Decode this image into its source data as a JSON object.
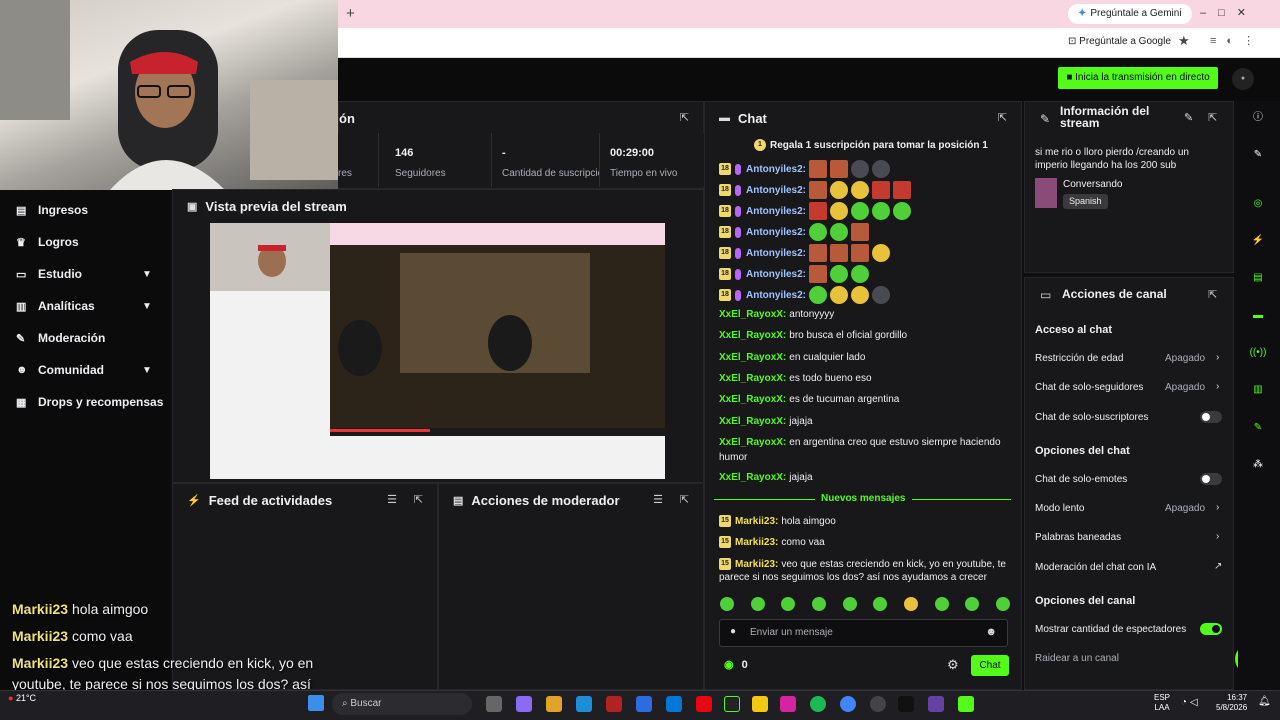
{
  "browser": {
    "gemini_label": "Pregúntale a Gemini",
    "google_label": "Pregúntale a Google",
    "new_tab": "+"
  },
  "topbar": {
    "golive_label": "Inicia la transmisión en directo"
  },
  "sidebar": {
    "items": [
      {
        "label": "Ingresos",
        "icon": "dollar-icon"
      },
      {
        "label": "Logros",
        "icon": "trophy-icon"
      },
      {
        "label": "Estudio",
        "icon": "studio-icon",
        "expandable": true
      },
      {
        "label": "Analíticas",
        "icon": "chart-icon",
        "expandable": true
      },
      {
        "label": "Moderación",
        "icon": "wrench-icon"
      },
      {
        "label": "Comunidad",
        "icon": "people-icon",
        "expandable": true
      },
      {
        "label": "Drops y recompensas",
        "icon": "gift-icon"
      }
    ]
  },
  "session": {
    "title_fragment": "ón",
    "stats": [
      {
        "value": "",
        "label": "res"
      },
      {
        "value": "146",
        "label": "Seguidores"
      },
      {
        "value": "-",
        "label": "Cantidad de suscripciones"
      },
      {
        "value": "00:29:00",
        "label": "Tiempo en vivo"
      }
    ]
  },
  "preview": {
    "title": "Vista previa del stream"
  },
  "activity": {
    "title": "Feed de actividades"
  },
  "modactions": {
    "title": "Acciones de moderador"
  },
  "chat": {
    "title": "Chat",
    "pinned": "Regala 1 suscripción para tomar la posición 1",
    "sub_rows": [
      {
        "badge": "18",
        "user": "Antonyiles2:"
      },
      {
        "badge": "18",
        "user": "Antonyiles2:"
      },
      {
        "badge": "18",
        "user": "Antonyiles2:"
      },
      {
        "badge": "18",
        "user": "Antonyiles2:"
      },
      {
        "badge": "18",
        "user": "Antonyiles2:"
      },
      {
        "badge": "18",
        "user": "Antonyiles2:"
      },
      {
        "badge": "18",
        "user": "Antonyiles2:"
      }
    ],
    "messages": [
      {
        "user": "XxEl_RayoxX:",
        "text": "antonyyyy"
      },
      {
        "user": "XxEl_RayoxX:",
        "text": "bro busca el oficial gordillo"
      },
      {
        "user": "XxEl_RayoxX:",
        "text": "en cualquier lado"
      },
      {
        "user": "XxEl_RayoxX:",
        "text": "es todo bueno eso"
      },
      {
        "user": "XxEl_RayoxX:",
        "text": "es de tucuman argentina"
      },
      {
        "user": "XxEl_RayoxX:",
        "text": "jajaja"
      },
      {
        "user": "XxEl_RayoxX:",
        "text": "en argentina creo que estuvo siempre haciendo"
      },
      {
        "user": "",
        "text": "humor"
      },
      {
        "user": "XxEl_RayoxX:",
        "text": "jajaja"
      }
    ],
    "new_divider": "Nuevos mensajes",
    "new_messages": [
      {
        "badge": "15",
        "user": "Markii23:",
        "text": "hola aimgoo"
      },
      {
        "badge": "15",
        "user": "Markii23:",
        "text": "como vaa"
      },
      {
        "badge": "15",
        "user": "Markii23:",
        "text": "veo que estas creciendo en kick, yo en youtube, te"
      },
      {
        "badge": "",
        "user": "",
        "text": "parece si nos seguimos los dos? así nos ayudamos a crecer"
      }
    ],
    "input_placeholder": "Enviar un mensaje",
    "points": "0",
    "send_label": "Chat"
  },
  "info": {
    "title_line1": "Información del",
    "title_line2": "stream",
    "stream_title_1": "si me rio o lloro pierdo /creando un",
    "stream_title_2": "imperio llegando ha los 200 sub",
    "category": "Conversando",
    "language": "Spanish"
  },
  "channel_actions": {
    "title": "Acciones de canal",
    "sec_chat_access": "Acceso al chat",
    "age_restriction": "Restricción de edad",
    "age_value": "Apagado",
    "followers_only": "Chat de solo-seguidores",
    "followers_value": "Apagado",
    "subs_only": "Chat de solo-suscriptores",
    "subs_on": false,
    "sec_chat_options": "Opciones del chat",
    "emotes_only": "Chat de solo-emotes",
    "emotes_on": false,
    "slow_mode": "Modo lento",
    "slow_value": "Apagado",
    "banned_words": "Palabras baneadas",
    "ai_moderation": "Moderación del chat con IA",
    "sec_channel_options": "Opciones del canal",
    "show_viewers": "Mostrar cantidad de espectadores",
    "show_viewers_on": true,
    "raid": "Raidear a un canal"
  },
  "overlay": [
    {
      "name": "Markii23",
      "text": "hola aimgoo"
    },
    {
      "name": "Markii23",
      "text": "como vaa"
    },
    {
      "name": "Markii23",
      "text": "veo que estas creciendo en kick, yo en"
    },
    {
      "name": "",
      "text": "youtube, te parece si nos seguimos los dos? así"
    }
  ],
  "taskbar": {
    "weather": "21°C",
    "search": "Buscar",
    "lang_1": "ESP",
    "lang_2": "LAA",
    "time": "16:37",
    "date": "5/8/2026"
  },
  "colors": {
    "accent": "#53fc18",
    "panel": "#18181b",
    "bg": "#0e0e10"
  }
}
